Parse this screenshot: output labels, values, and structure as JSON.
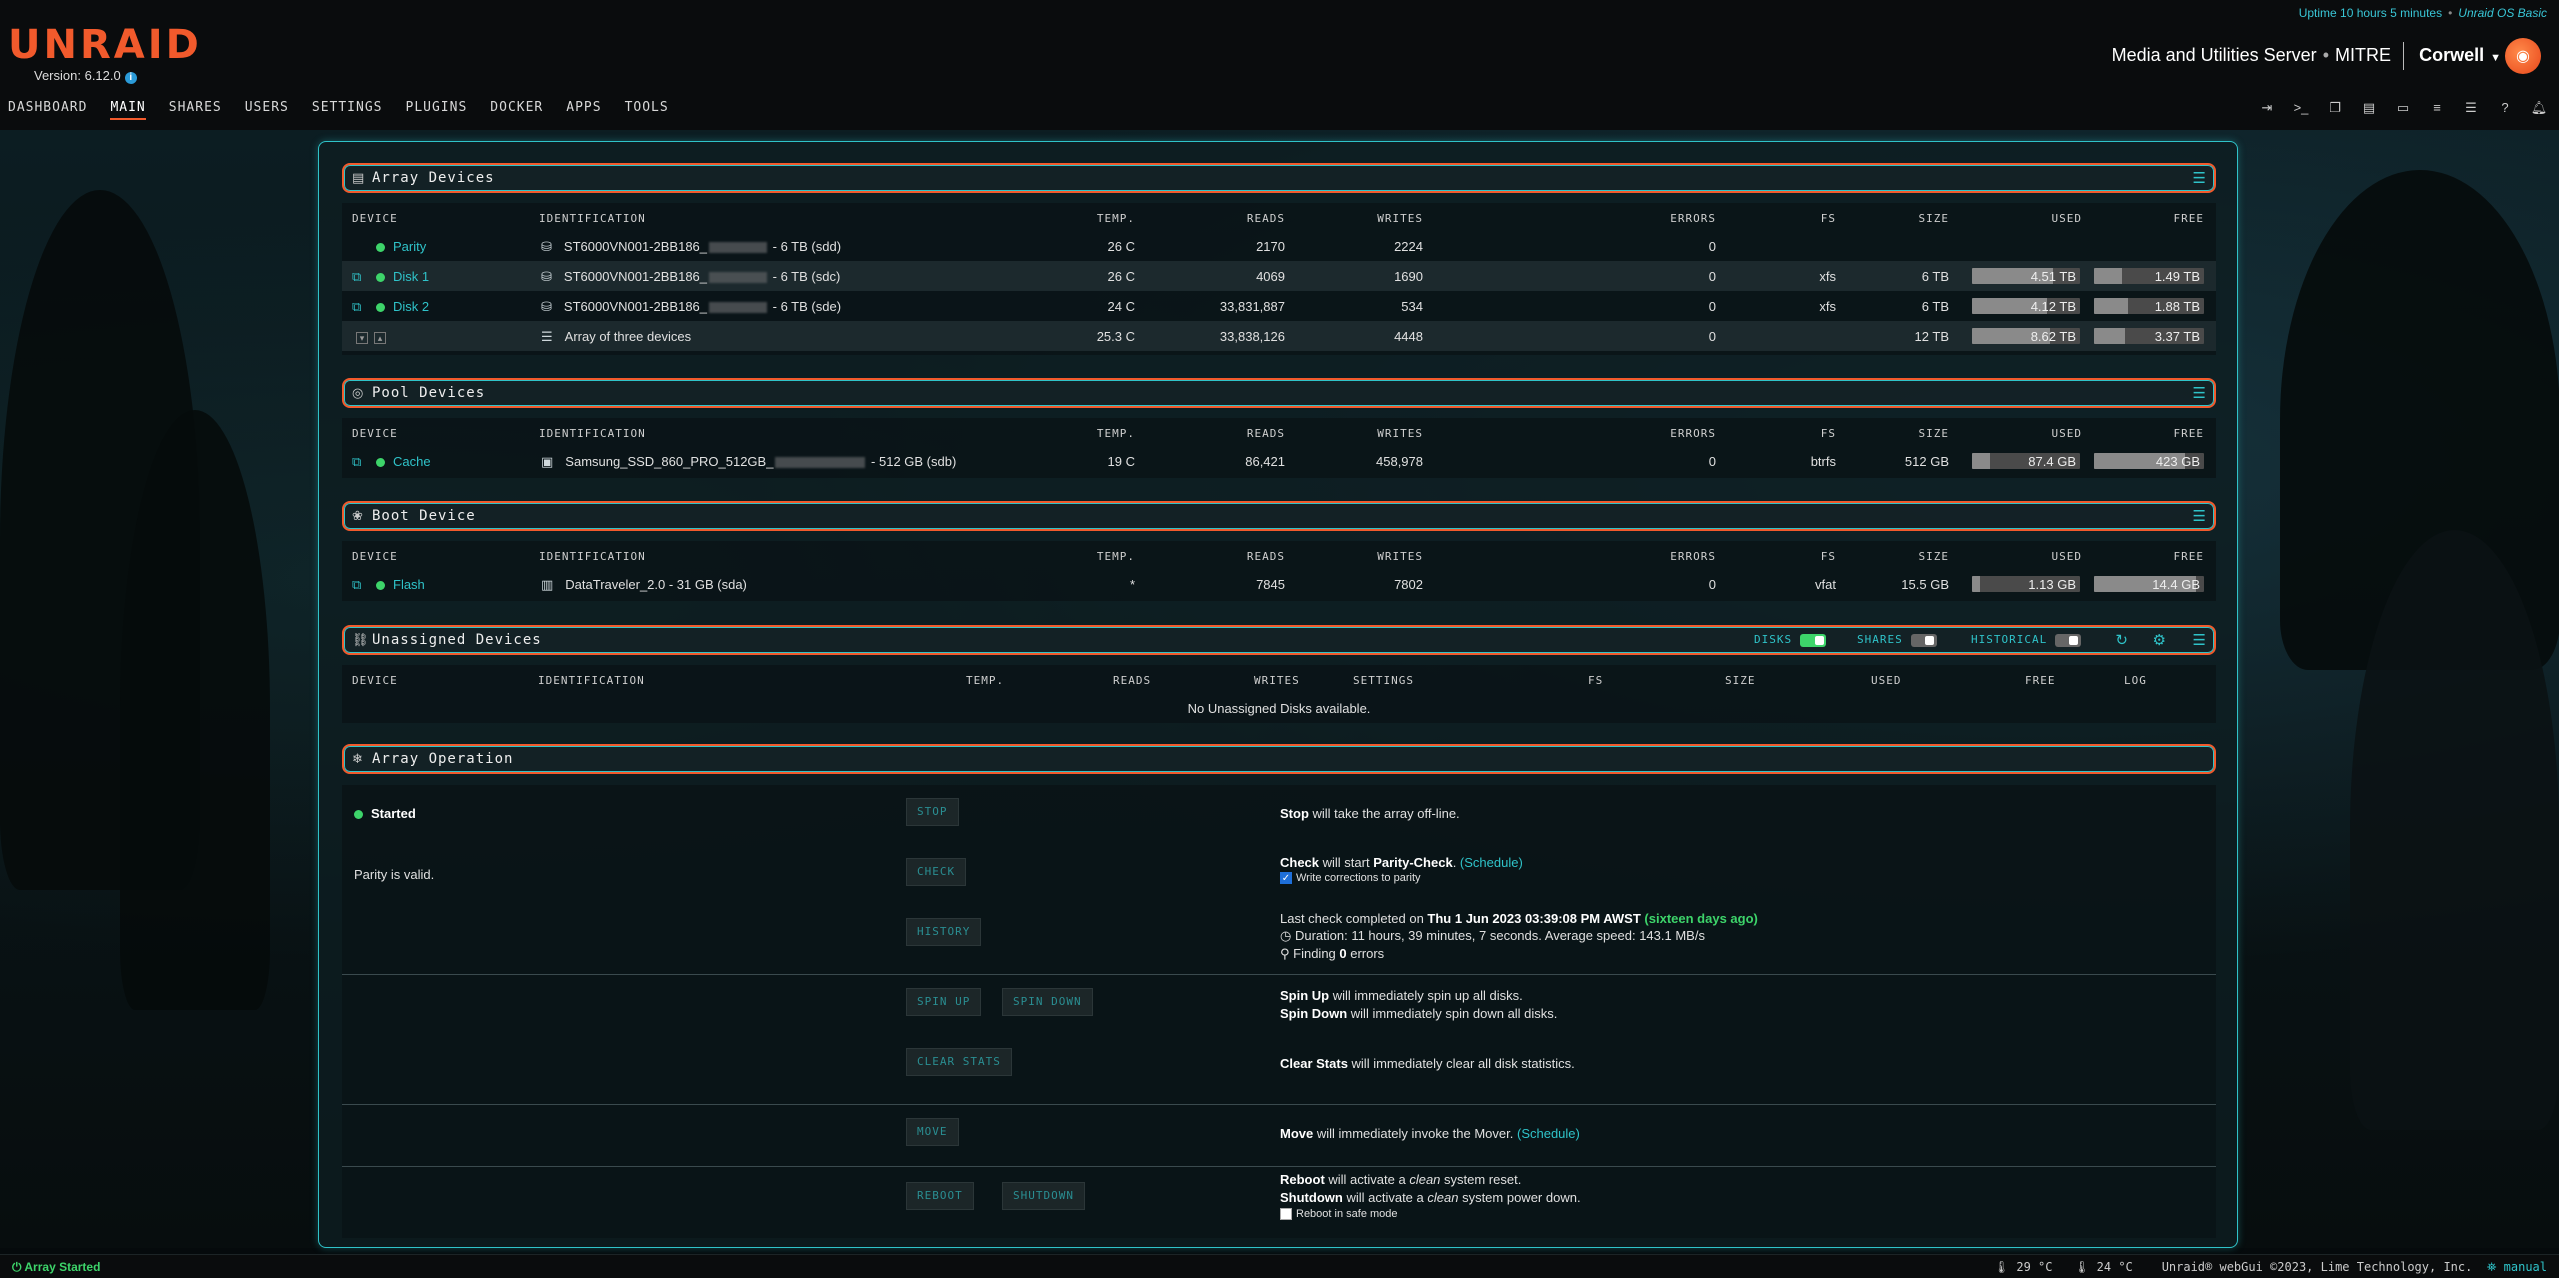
{
  "header": {
    "logo": "UNRAID",
    "version": "Version: 6.12.0",
    "uptime": "Uptime 10 hours 5 minutes",
    "license": "Unraid OS Basic",
    "server_name": "Media and Utilities Server",
    "server_location": "MITRE",
    "user": "Corwell"
  },
  "nav": [
    "DASHBOARD",
    "MAIN",
    "SHARES",
    "USERS",
    "SETTINGS",
    "PLUGINS",
    "DOCKER",
    "APPS",
    "TOOLS"
  ],
  "nav_active": "MAIN",
  "toolbar_icons": [
    "logout-icon",
    "terminal-icon",
    "new-window-icon",
    "log-icon",
    "display-icon",
    "list-icon",
    "tasks-icon",
    "help-icon",
    "bell-icon"
  ],
  "columns": {
    "device": "DEVICE",
    "identification": "IDENTIFICATION",
    "temp": "TEMP.",
    "reads": "READS",
    "writes": "WRITES",
    "errors": "ERRORS",
    "fs": "FS",
    "size": "SIZE",
    "used": "USED",
    "free": "FREE",
    "settings": "SETTINGS",
    "log": "LOG"
  },
  "array": {
    "title": "Array Devices",
    "rows": [
      {
        "name": "Parity",
        "id_prefix": "ST6000VN001-2BB186_",
        "id_suffix": " - 6 TB (sdd)",
        "temp": "26 C",
        "reads": "2170",
        "writes": "2224",
        "errors": "0",
        "fs": "",
        "size": "",
        "used": "",
        "free": "",
        "used_frac": 0,
        "free_frac": 0
      },
      {
        "name": "Disk 1",
        "id_prefix": "ST6000VN001-2BB186_",
        "id_suffix": " - 6 TB (sdc)",
        "temp": "26 C",
        "reads": "4069",
        "writes": "1690",
        "errors": "0",
        "fs": "xfs",
        "size": "6 TB",
        "used": "4.51 TB",
        "free": "1.49 TB",
        "used_frac": 0.75,
        "free_frac": 0.25
      },
      {
        "name": "Disk 2",
        "id_prefix": "ST6000VN001-2BB186_",
        "id_suffix": " - 6 TB (sde)",
        "temp": "24 C",
        "reads": "33,831,887",
        "writes": "534",
        "errors": "0",
        "fs": "xfs",
        "size": "6 TB",
        "used": "4.12 TB",
        "free": "1.88 TB",
        "used_frac": 0.69,
        "free_frac": 0.31
      }
    ],
    "total": {
      "label": "Array of three devices",
      "temp": "25.3 C",
      "reads": "33,838,126",
      "writes": "4448",
      "errors": "0",
      "size": "12 TB",
      "used": "8.62 TB",
      "free": "3.37 TB",
      "used_frac": 0.72,
      "free_frac": 0.28
    }
  },
  "pool": {
    "title": "Pool Devices",
    "rows": [
      {
        "name": "Cache",
        "id_prefix": "Samsung_SSD_860_PRO_512GB_",
        "id_suffix": " - 512 GB (sdb)",
        "temp": "19 C",
        "reads": "86,421",
        "writes": "458,978",
        "errors": "0",
        "fs": "btrfs",
        "size": "512 GB",
        "used": "87.4 GB",
        "free": "423 GB",
        "used_frac": 0.17,
        "free_frac": 0.83
      }
    ]
  },
  "boot": {
    "title": "Boot Device",
    "rows": [
      {
        "name": "Flash",
        "id": "DataTraveler_2.0 - 31 GB (sda)",
        "temp": "*",
        "reads": "7845",
        "writes": "7802",
        "errors": "0",
        "fs": "vfat",
        "size": "15.5 GB",
        "used": "1.13 GB",
        "free": "14.4 GB",
        "used_frac": 0.07,
        "free_frac": 0.93
      }
    ]
  },
  "unassigned": {
    "title": "Unassigned Devices",
    "toggles": {
      "disks": "DISKS",
      "shares": "SHARES",
      "historical": "HISTORICAL"
    },
    "empty": "No Unassigned Disks available."
  },
  "operation": {
    "title": "Array Operation",
    "status": "Started",
    "parity": "Parity is valid.",
    "buttons": {
      "stop": "STOP",
      "check": "CHECK",
      "history": "HISTORY",
      "spin_up": "SPIN UP",
      "spin_down": "SPIN DOWN",
      "clear_stats": "CLEAR STATS",
      "move": "MOVE",
      "reboot": "REBOOT",
      "shutdown": "SHUTDOWN"
    },
    "stop_b": "Stop",
    "stop_t": " will take the array off-line.",
    "check_b": "Check",
    "check_t": " will start ",
    "check_b2": "Parity-Check",
    "check_t2": ". ",
    "schedule": "(Schedule)",
    "write_corrections": "Write corrections to parity",
    "last_check_t": "Last check completed on ",
    "last_check_b": "Thu 1 Jun 2023 03:39:08 PM AWST",
    "last_check_ago": "(sixteen days ago)",
    "duration": "Duration: 11 hours, 39 minutes, 7 seconds. Average speed: 143.1 MB/s",
    "finding_t": "Finding ",
    "finding_b": "0",
    "finding_t2": " errors",
    "spin_up_b": "Spin Up",
    "spin_up_t": " will immediately spin up all disks.",
    "spin_down_b": "Spin Down",
    "spin_down_t": " will immediately spin down all disks.",
    "clear_b": "Clear Stats",
    "clear_t": " will immediately clear all disk statistics.",
    "move_b": "Move",
    "move_t": " will immediately invoke the Mover. ",
    "reboot_b": "Reboot",
    "reboot_t": " will activate a ",
    "reboot_i": "clean",
    "reboot_t2": " system reset.",
    "shutdown_b": "Shutdown",
    "shutdown_t": " will activate a ",
    "shutdown_i": "clean",
    "shutdown_t2": " system power down.",
    "safe_mode": "Reboot in safe mode"
  },
  "footer": {
    "status": "Array Started",
    "cpu_temp": "29 °C",
    "mb_temp": "24 °C",
    "copyright": "Unraid® webGui ©2023, Lime Technology, Inc.",
    "manual": "manual"
  },
  "colors": {
    "accent": "#f15a2c",
    "teal": "#2fc3c9",
    "green": "#3dd46a"
  }
}
